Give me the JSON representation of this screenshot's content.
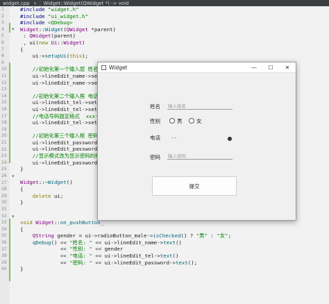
{
  "tabs": [
    {
      "label": "widget.cpp",
      "close": "×"
    },
    {
      "label": "Widget::Widget(QWidget *) -> void",
      "close": ""
    }
  ],
  "line_numbers": [
    "1",
    "2",
    "3",
    "4",
    "5",
    "6",
    "7",
    "8",
    "9",
    "10",
    "11",
    "12",
    "13",
    "14",
    "15",
    "16",
    "17",
    "18",
    "19",
    "20",
    "21",
    "22",
    "23",
    "24",
    "25",
    "26",
    "27",
    "28",
    "29",
    "30",
    "31",
    "32",
    "33",
    "34",
    "35",
    "36",
    "37",
    "38",
    "39",
    "40"
  ],
  "code": [
    [
      [
        "pp",
        "#include "
      ],
      [
        "str",
        "\"widget.h\""
      ]
    ],
    [
      [
        "pp",
        "#include "
      ],
      [
        "str",
        "\"ui_widget.h\""
      ]
    ],
    [
      [
        "pp",
        "#include "
      ],
      [
        "str",
        "<QDebug>"
      ]
    ],
    [
      [
        "ty",
        "Widget"
      ],
      [
        "",
        "::"
      ],
      [
        "fn",
        "Widget"
      ],
      [
        "",
        "("
      ],
      [
        "ty",
        "QWidget"
      ],
      [
        "",
        " *parent)"
      ]
    ],
    [
      [
        "",
        " : "
      ],
      [
        "ty",
        "QWidget"
      ],
      [
        "",
        "(parent)"
      ]
    ],
    [
      [
        "",
        " , ui("
      ],
      [
        "kw",
        "new "
      ],
      [
        "ty",
        "Ui"
      ],
      [
        "",
        "::"
      ],
      [
        "ty",
        "Widget"
      ],
      [
        "",
        ")"
      ]
    ],
    [
      [
        "",
        "{"
      ]
    ],
    [
      [
        "",
        "    ui->"
      ],
      [
        "fn",
        "setupUi"
      ],
      [
        "",
        "("
      ],
      [
        "kw",
        "this"
      ],
      [
        "",
        ");"
      ]
    ],
    [
      [
        "",
        ""
      ]
    ],
    [
      [
        "cm",
        "    //初始化第一个输入层 姓名"
      ]
    ],
    [
      [
        "",
        "    ui->lineEdit_name->set"
      ]
    ],
    [
      [
        "",
        "    ui->lineEdit_name->set"
      ]
    ],
    [
      [
        "",
        ""
      ]
    ],
    [
      [
        "cm",
        "    //初始化第二个输入框 电话"
      ]
    ],
    [
      [
        "",
        "    ui->lineEdit_tel->setP"
      ]
    ],
    [
      [
        "",
        "    ui->lineEdit_tel->setC"
      ]
    ],
    [
      [
        "cm",
        "    //电话号码固定格式  xxx-x"
      ]
    ],
    [
      [
        "",
        "    ui->lineEdit_tel->setI"
      ]
    ],
    [
      [
        "",
        ""
      ]
    ],
    [
      [
        "cm",
        "    //初始化第三个输入框 密码"
      ]
    ],
    [
      [
        "",
        "    ui->lineEdit_password-"
      ]
    ],
    [
      [
        "",
        "    ui->lineEdit_password-"
      ]
    ],
    [
      [
        "cm",
        "    //显示模式改为显示密码的模"
      ]
    ],
    [
      [
        "",
        "    ui->lineEdit_password-"
      ]
    ],
    [
      [
        "",
        "}"
      ]
    ],
    [
      [
        "",
        ""
      ]
    ],
    [
      [
        "ty",
        "Widget"
      ],
      [
        "",
        "::"
      ],
      [
        "fn ital",
        "~Widget"
      ],
      [
        "",
        "()"
      ]
    ],
    [
      [
        "",
        "{"
      ]
    ],
    [
      [
        "kw",
        "    delete "
      ],
      [
        "",
        "ui;"
      ]
    ],
    [
      [
        "",
        "}"
      ]
    ],
    [
      [
        "",
        ""
      ]
    ],
    [
      [
        "",
        ""
      ]
    ],
    [
      [
        "kw",
        "void "
      ],
      [
        "ty",
        "Widget"
      ],
      [
        "",
        "::"
      ],
      [
        "fn",
        "on_pushButton_"
      ]
    ],
    [
      [
        "",
        "{"
      ]
    ],
    [
      [
        "",
        "    "
      ],
      [
        "ty",
        "QString"
      ],
      [
        "",
        " gender = ui->radioButton_male->"
      ],
      [
        "fn",
        "isChecked"
      ],
      [
        "",
        "() ? "
      ],
      [
        "str",
        "\"男\""
      ],
      [
        "",
        " : "
      ],
      [
        "str",
        "\"女\""
      ],
      [
        "",
        ";"
      ]
    ],
    [
      [
        "",
        "    "
      ],
      [
        "fn",
        "qDebug"
      ],
      [
        "",
        "() << "
      ],
      [
        "str",
        "\"姓名: \""
      ],
      [
        "",
        " << ui->lineEdit_name->"
      ],
      [
        "fn",
        "text"
      ],
      [
        "",
        "()"
      ]
    ],
    [
      [
        "",
        "             << "
      ],
      [
        "str",
        "\"性别: \""
      ],
      [
        "",
        " << gender"
      ]
    ],
    [
      [
        "",
        "             << "
      ],
      [
        "str",
        "\"电话: \""
      ],
      [
        "",
        " << ui->lineEdit_tel->"
      ],
      [
        "fn",
        "text"
      ],
      [
        "",
        "()"
      ]
    ],
    [
      [
        "",
        "             << "
      ],
      [
        "str",
        "\"密码: \""
      ],
      [
        "",
        " << ui->lineEdit_password->"
      ],
      [
        "fn",
        "text"
      ],
      [
        "",
        "();"
      ]
    ],
    [
      [
        "",
        "}"
      ]
    ]
  ],
  "window": {
    "title": "Widget",
    "minimize": "—",
    "maximize": "☐",
    "close": "✕"
  },
  "form": {
    "name_label": "姓名",
    "name_placeholder": "输入姓名",
    "gender_label": "性别",
    "male": "男",
    "female": "女",
    "tel_label": "电话",
    "tel_value": "-  -",
    "password_label": "密码",
    "password_placeholder": "输入密码",
    "submit": "提交"
  },
  "icons": {
    "app": "window-icon",
    "clear": "clear-icon"
  }
}
